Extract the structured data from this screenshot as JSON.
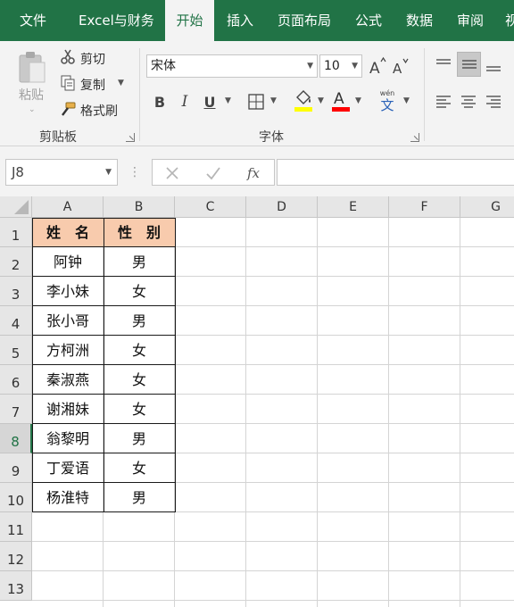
{
  "ribbon_tabs": [
    {
      "label": "文件"
    },
    {
      "label": "Excel与财务"
    },
    {
      "label": "开始"
    },
    {
      "label": "插入"
    },
    {
      "label": "页面布局"
    },
    {
      "label": "公式"
    },
    {
      "label": "数据"
    },
    {
      "label": "审阅"
    },
    {
      "label": "视"
    }
  ],
  "active_tab": "开始",
  "clipboard": {
    "paste_label": "粘贴",
    "cut_label": "剪切",
    "copy_label": "复制",
    "format_painter_label": "格式刷",
    "group_label": "剪贴板"
  },
  "font": {
    "font_name": "宋体",
    "font_size": "10",
    "bold_label": "B",
    "italic_label": "I",
    "underline_label": "U",
    "phonetic_label": "wén",
    "phonetic_char": "文",
    "group_label": "字体",
    "fill_color": "#ffff00",
    "font_color": "#ff0000"
  },
  "formula_bar": {
    "name_box": "J8",
    "fx_label": "fx",
    "formula": ""
  },
  "columns": [
    "A",
    "B",
    "C",
    "D",
    "E",
    "F",
    "G"
  ],
  "rows": [
    "1",
    "2",
    "3",
    "4",
    "5",
    "6",
    "7",
    "8",
    "9",
    "10",
    "11",
    "12",
    "13"
  ],
  "selected_row": "8",
  "table": {
    "header": [
      "姓　名",
      "性　别"
    ],
    "header_fill": "#f8cbad",
    "rows": [
      [
        "阿钟",
        "男"
      ],
      [
        "李小妹",
        "女"
      ],
      [
        "张小哥",
        "男"
      ],
      [
        "方柯洲",
        "女"
      ],
      [
        "秦淑燕",
        "女"
      ],
      [
        "谢湘妹",
        "女"
      ],
      [
        "翁黎明",
        "男"
      ],
      [
        "丁爱语",
        "女"
      ],
      [
        "杨淮特",
        "男"
      ]
    ]
  },
  "theme": {
    "accent": "#217346"
  }
}
